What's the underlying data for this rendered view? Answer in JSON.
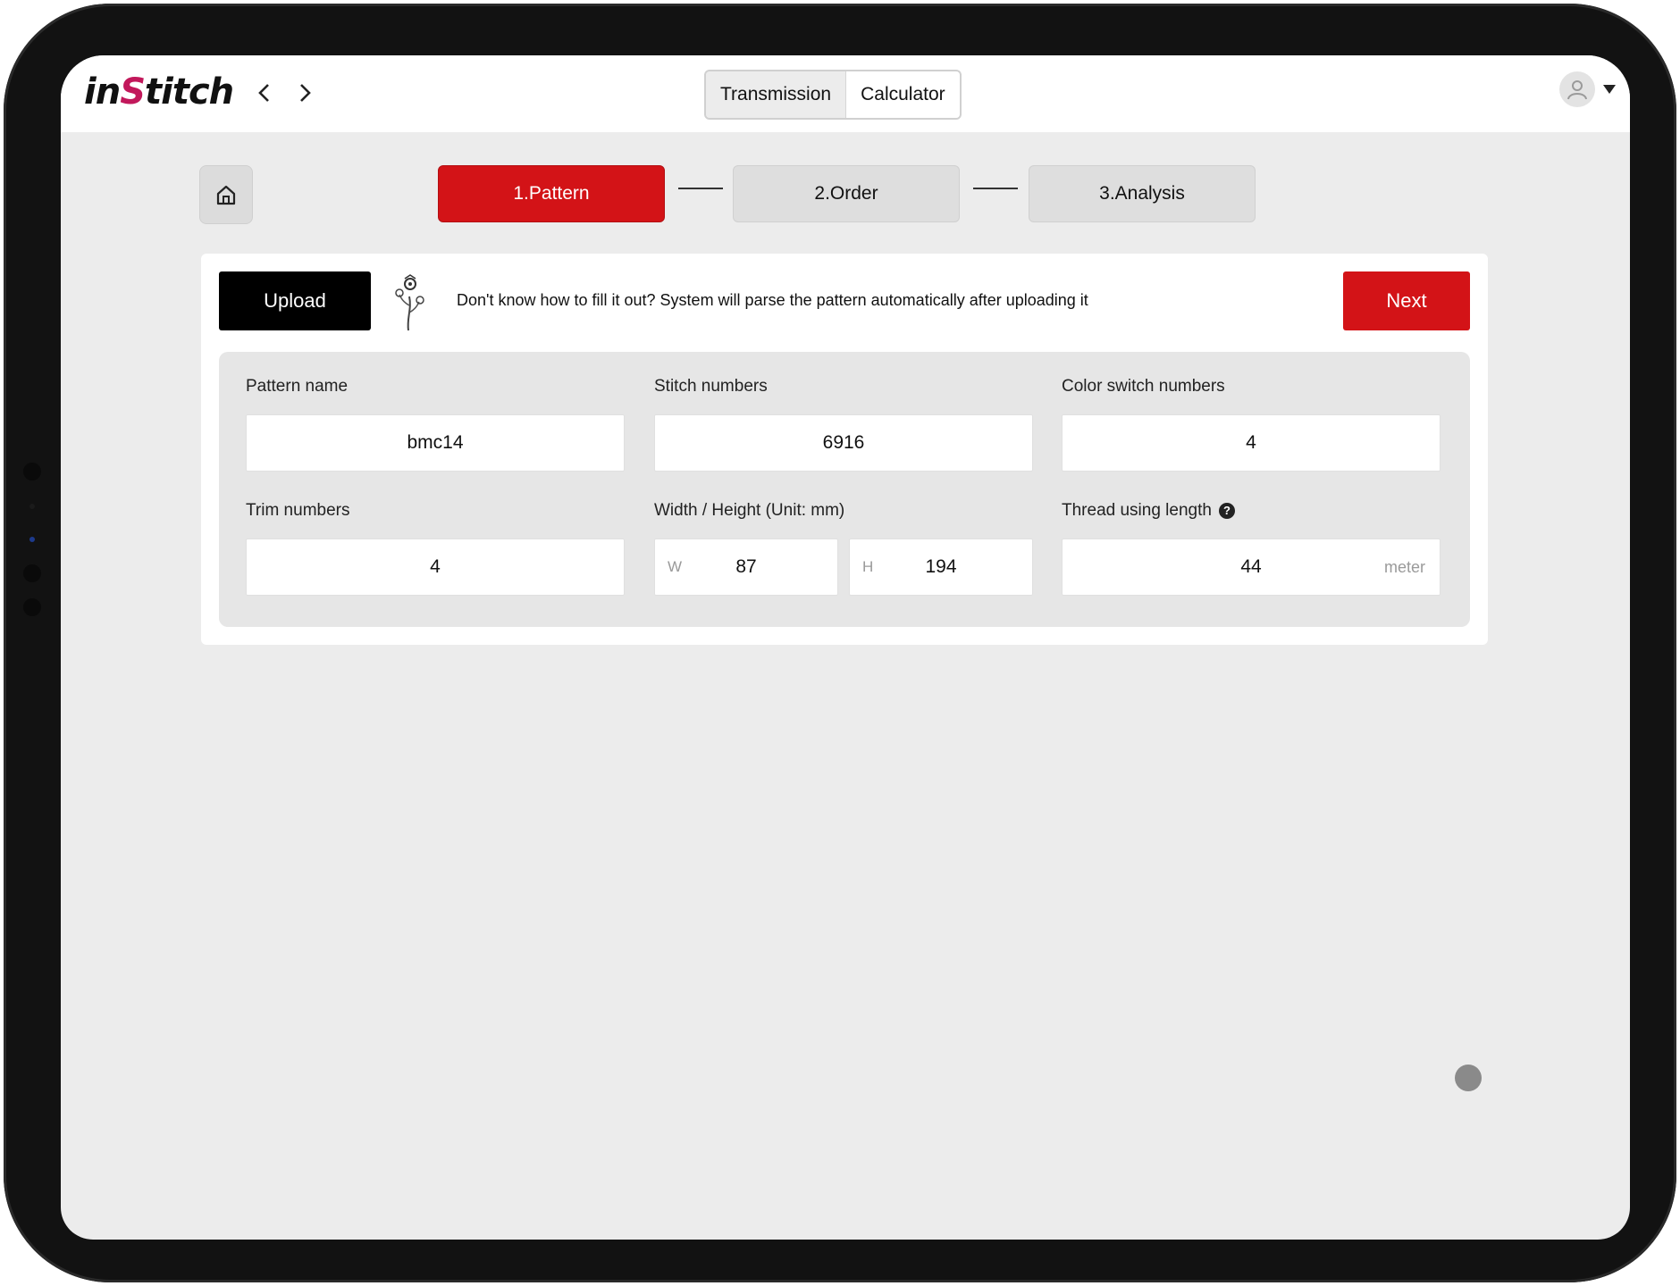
{
  "app": {
    "logo_prefix": "in",
    "logo_s": "S",
    "logo_suffix": "titch",
    "nav": {
      "back_icon": "chevron-left-icon",
      "forward_icon": "chevron-right-icon"
    },
    "tabs": [
      {
        "label": "Transmission",
        "active": true
      },
      {
        "label": "Calculator",
        "active": false
      }
    ],
    "avatar_icon": "user-icon",
    "menu_icon": "caret-down-icon"
  },
  "steps": [
    {
      "label": "1.Pattern",
      "active": true
    },
    {
      "label": "2.Order",
      "active": false
    },
    {
      "label": "3.Analysis",
      "active": false
    }
  ],
  "toolbar": {
    "upload_label": "Upload",
    "hint": "Don't know how to fill it out? System will parse the pattern automatically after uploading it",
    "next_label": "Next"
  },
  "form": {
    "pattern_name": {
      "label": "Pattern name",
      "value": "bmc14"
    },
    "stitch_numbers": {
      "label": "Stitch numbers",
      "value": "6916"
    },
    "color_switch_numbers": {
      "label": "Color switch numbers",
      "value": "4"
    },
    "trim_numbers": {
      "label": "Trim numbers",
      "value": "4"
    },
    "dimensions": {
      "label": "Width / Height (Unit: mm)",
      "width_prefix": "W",
      "width_value": "87",
      "height_prefix": "H",
      "height_value": "194"
    },
    "thread_length": {
      "label": "Thread using length",
      "value": "44",
      "unit": "meter",
      "help_symbol": "?"
    }
  },
  "colors": {
    "accent": "#d31317",
    "upload": "#000000",
    "panel": "#e6e6e6"
  }
}
